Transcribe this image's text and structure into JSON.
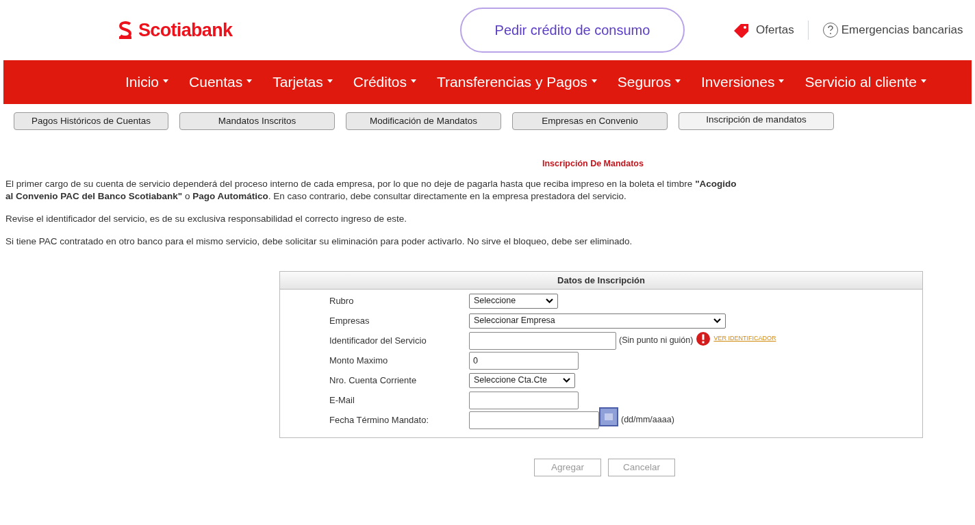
{
  "header": {
    "logo": "Scotiabank",
    "cta": "Pedir crédito de consumo",
    "links": [
      "Ofertas",
      "Emergencias bancarias"
    ]
  },
  "nav": [
    "Inicio",
    "Cuentas",
    "Tarjetas",
    "Créditos",
    "Transferencias y Pagos",
    "Seguros",
    "Inversiones",
    "Servicio al cliente"
  ],
  "subtabs": [
    {
      "label": "Pagos Históricos de Cuentas",
      "selected": false
    },
    {
      "label": "Mandatos Inscritos",
      "selected": false
    },
    {
      "label": "Modificación de Mandatos",
      "selected": false
    },
    {
      "label": "Empresas en Convenio",
      "selected": false
    },
    {
      "label": "Inscripción de mandatos",
      "selected": true
    }
  ],
  "title": "Inscripción De Mandatos",
  "paragraphs": [
    "El primer cargo de su cuenta de servicio dependerá del proceso interno de cada empresa, por lo que no deje de pagarla hasta que reciba impreso en la boleta el timbre **\"Acogido al Convenio PAC del Banco Scotiabank\"** o **Pago Automático**. En caso contrario, debe consultar directamente en la empresa prestadora del servicio.",
    "Revise el identificador del servicio, es de su exclusiva responsabilidad el correcto ingreso de este.",
    "Si tiene PAC contratado en otro banco para el mismo servicio, debe solicitar su eliminación para poder activarlo. No sirve el bloqueo, debe ser eliminado."
  ],
  "form": {
    "title": "Datos de Inscripción",
    "fields": [
      {
        "label": "Rubro",
        "kind": "select",
        "value": "Seleccione"
      },
      {
        "label": "Empresas",
        "kind": "select",
        "value": "Seleccionar Empresa"
      },
      {
        "label": "Identificador del Servicio",
        "kind": "input",
        "hint": "(Sin punto ni guión)",
        "link": "VER IDENTIFICADOR"
      },
      {
        "label": "Monto Maximo",
        "kind": "input",
        "value": "0"
      },
      {
        "label": "Nro. Cuenta Corriente",
        "kind": "select",
        "value": "Seleccione Cta.Cte"
      },
      {
        "label": "E-Mail",
        "kind": "input"
      },
      {
        "label": "Fecha Término Mandato:",
        "kind": "date",
        "hint": "(dd/mm/aaaa)"
      }
    ]
  },
  "buttons": [
    {
      "label": "Agregar",
      "disabled": true
    },
    {
      "label": "Cancelar",
      "disabled": true
    }
  ]
}
